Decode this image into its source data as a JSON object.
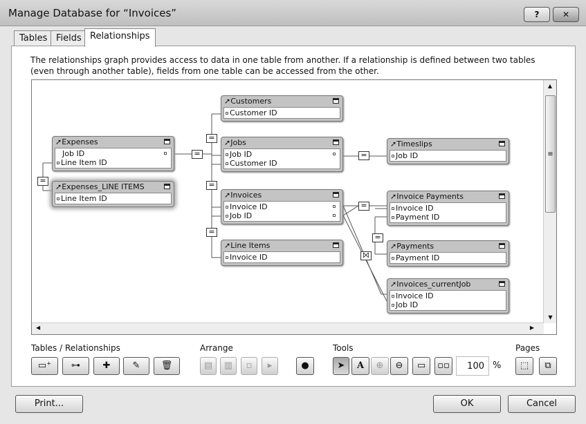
{
  "window": {
    "title": "Manage Database for “Invoices”",
    "help": "?",
    "close": "✕"
  },
  "tabs": [
    {
      "label": "Tables"
    },
    {
      "label": "Fields"
    },
    {
      "label": "Relationships"
    }
  ],
  "description": "The relationships graph provides access to data in one table from another. If a relationship is defined between two tables (even through another table), fields from one table can be accessed from the other.",
  "tables": [
    {
      "name": "Expenses",
      "fields": [
        "Job ID",
        "Line Item ID"
      ]
    },
    {
      "name": "Expenses_LINE ITEMS",
      "fields": [
        "Line Item ID"
      ]
    },
    {
      "name": "Customers",
      "fields": [
        "Customer ID"
      ]
    },
    {
      "name": "Jobs",
      "fields": [
        "Job ID",
        "Customer ID"
      ]
    },
    {
      "name": "Invoices",
      "fields": [
        "Invoice ID",
        "Job ID"
      ]
    },
    {
      "name": "Line Items",
      "fields": [
        "Invoice ID"
      ]
    },
    {
      "name": "Timeslips",
      "fields": [
        "Job ID"
      ]
    },
    {
      "name": "Invoice Payments",
      "fields": [
        "Invoice ID",
        "Payment ID"
      ]
    },
    {
      "name": "Payments",
      "fields": [
        "Payment ID"
      ]
    },
    {
      "name": "Invoices_currentJob",
      "fields": [
        "Invoice ID",
        "Job ID"
      ]
    }
  ],
  "operators": {
    "equal": "=",
    "cross": "⨝"
  },
  "toolbar": {
    "tables_relationships": "Tables / Relationships",
    "arrange": "Arrange",
    "tools": "Tools",
    "pages": "Pages",
    "zoom": "100",
    "percent": "%",
    "text_tool": "A"
  },
  "footer": {
    "print": "Print...",
    "ok": "OK",
    "cancel": "Cancel"
  }
}
